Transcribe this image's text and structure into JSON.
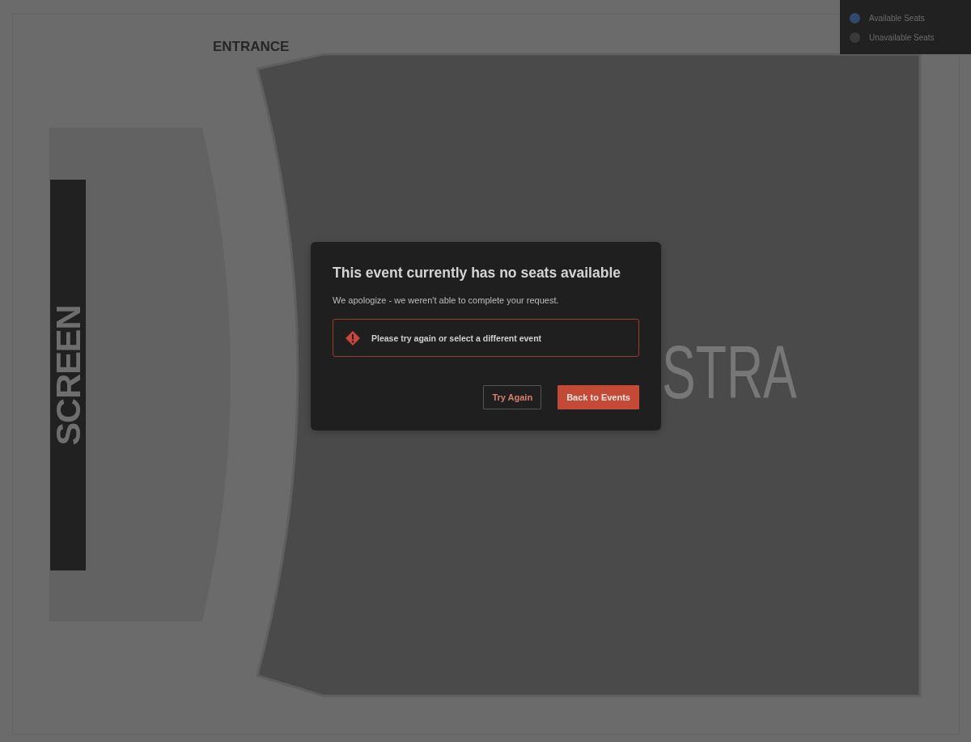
{
  "legend": {
    "items": [
      {
        "label": "Available Seats",
        "color": "#2f4a6e"
      },
      {
        "label": "Unavailable Seats",
        "color": "#3a3a3a"
      }
    ]
  },
  "seat_map": {
    "entrance_label": "ENTRANCE",
    "screen_label": "SCREEN",
    "section_label": "STRA"
  },
  "dialog": {
    "title": "This event currently has no seats available",
    "message": "We apologize - we weren't able to complete your request.",
    "alert": {
      "text": "Please try again or select a different event"
    },
    "buttons": [
      {
        "label": "Try Again",
        "kind": "secondary"
      },
      {
        "label": "Back to Events",
        "kind": "primary"
      }
    ]
  }
}
